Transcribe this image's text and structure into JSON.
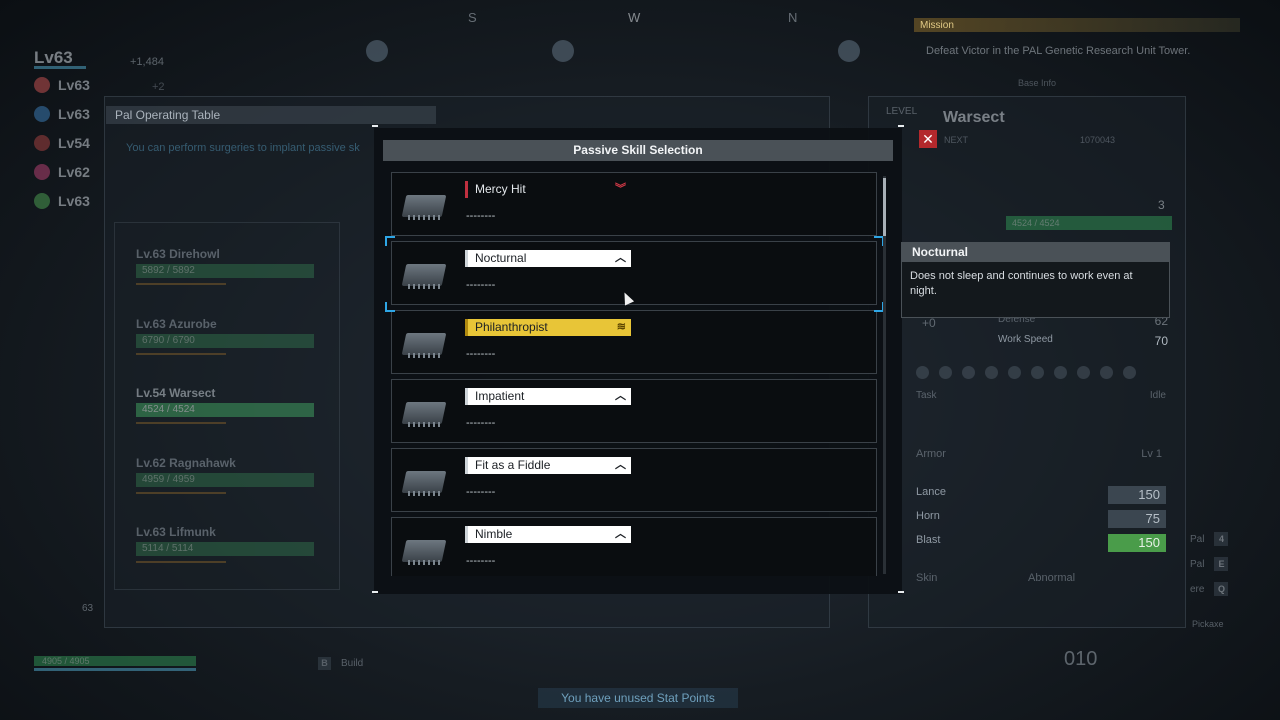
{
  "compass": {
    "s": "S",
    "w": "W",
    "n": "N"
  },
  "player": {
    "level": "Lv63",
    "exp": "+1,484",
    "exp2": "+2"
  },
  "party": [
    {
      "level": "Lv63",
      "color": "#c05050"
    },
    {
      "level": "Lv63",
      "color": "#3a78b0"
    },
    {
      "level": "Lv54",
      "color": "#a04040"
    },
    {
      "level": "Lv62",
      "color": "#b04070"
    },
    {
      "level": "Lv63",
      "color": "#4a9a50"
    }
  ],
  "mission": {
    "label": "Mission",
    "text": "Defeat Victor in the PAL Genetic Research Unit Tower.",
    "sub": "Base Info"
  },
  "operating_table": {
    "title": "Pal Operating Table",
    "description": "You can perform surgeries to implant passive sk",
    "pals": [
      {
        "name": "Lv.63 Direhowl",
        "hp": "5892 / 5892",
        "selected": false
      },
      {
        "name": "Lv.63 Azurobe",
        "hp": "6790 / 6790",
        "selected": false
      },
      {
        "name": "Lv.54 Warsect",
        "hp": "4524 / 4524",
        "selected": true
      },
      {
        "name": "Lv.62 Ragnahawk",
        "hp": "4959 / 4959",
        "selected": false
      },
      {
        "name": "Lv.63 Lifmunk",
        "hp": "5114 / 5114",
        "selected": false
      }
    ]
  },
  "stats_panel": {
    "level_label": "LEVEL",
    "pal_name": "Warsect",
    "next_label": "NEXT",
    "next_value": "1070043",
    "hp": "4524 / 4524",
    "rank": "3",
    "defense_label": "Defense",
    "defense_value": "62",
    "work_speed_label": "Work Speed",
    "work_speed_value": "70",
    "plus_zero": "+0",
    "task_label": "Task",
    "task_value": "Idle",
    "armor_label": "Armor",
    "armor_level": "Lv 1",
    "equipment": [
      {
        "name": "Lance",
        "value": "150",
        "color": "gray"
      },
      {
        "name": "Horn",
        "value": "75",
        "color": "gray"
      },
      {
        "name": "Blast",
        "value": "150",
        "color": "green"
      }
    ],
    "skin_label": "Skin",
    "abnormal_label": "Abnormal",
    "side_keys": [
      {
        "label": "Pal",
        "key": "4"
      },
      {
        "label": "Pal",
        "key": "E"
      },
      {
        "label": "ere",
        "key": "Q"
      }
    ],
    "pickaxe": "Pickaxe"
  },
  "bottom_hud": {
    "hp": "4905 / 4905",
    "build_key": "B",
    "build_label": "Build",
    "level_badge": "63",
    "unused_stat": "You have unused Stat Points",
    "ammo": "010"
  },
  "modal": {
    "title": "Passive Skill Selection",
    "skills": [
      {
        "name": "Mercy Hit",
        "rank_icon": "︾",
        "style": "mercy",
        "desc": "--------"
      },
      {
        "name": "Nocturnal",
        "rank_icon": "︿",
        "style": "white",
        "desc": "--------"
      },
      {
        "name": "Philanthropist",
        "rank_icon": "≋",
        "style": "gold",
        "desc": "--------"
      },
      {
        "name": "Impatient",
        "rank_icon": "︿",
        "style": "white",
        "desc": "--------"
      },
      {
        "name": "Fit as a Fiddle",
        "rank_icon": "︿",
        "style": "white",
        "desc": "--------"
      },
      {
        "name": "Nimble",
        "rank_icon": "︿",
        "style": "white",
        "desc": "--------"
      }
    ]
  },
  "tooltip": {
    "title": "Nocturnal",
    "description": "Does not sleep and continues to work even at night."
  }
}
